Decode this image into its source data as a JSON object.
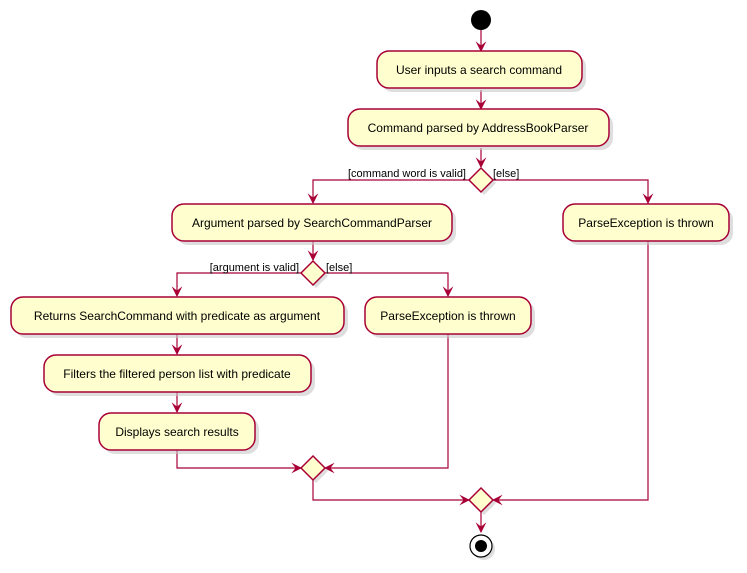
{
  "diagram": {
    "type": "activity",
    "colors": {
      "node_fill": "#FEFECE",
      "node_border": "#A80036",
      "edge": "#A80036",
      "start": "#000000"
    },
    "activities": {
      "user_inputs": "User inputs a search command",
      "command_parsed": "Command parsed by AddressBookParser",
      "argument_parsed": "Argument parsed by SearchCommandParser",
      "parse_exception_outer": "ParseException is thrown",
      "returns_search_command": "Returns SearchCommand with predicate as argument",
      "parse_exception_inner": "ParseException is thrown",
      "filters_list": "Filters the filtered person list with predicate",
      "displays_results": "Displays search results"
    },
    "guards": {
      "command_valid": "[command word is valid]",
      "command_else": "[else]",
      "argument_valid": "[argument is valid]",
      "argument_else": "[else]"
    }
  }
}
